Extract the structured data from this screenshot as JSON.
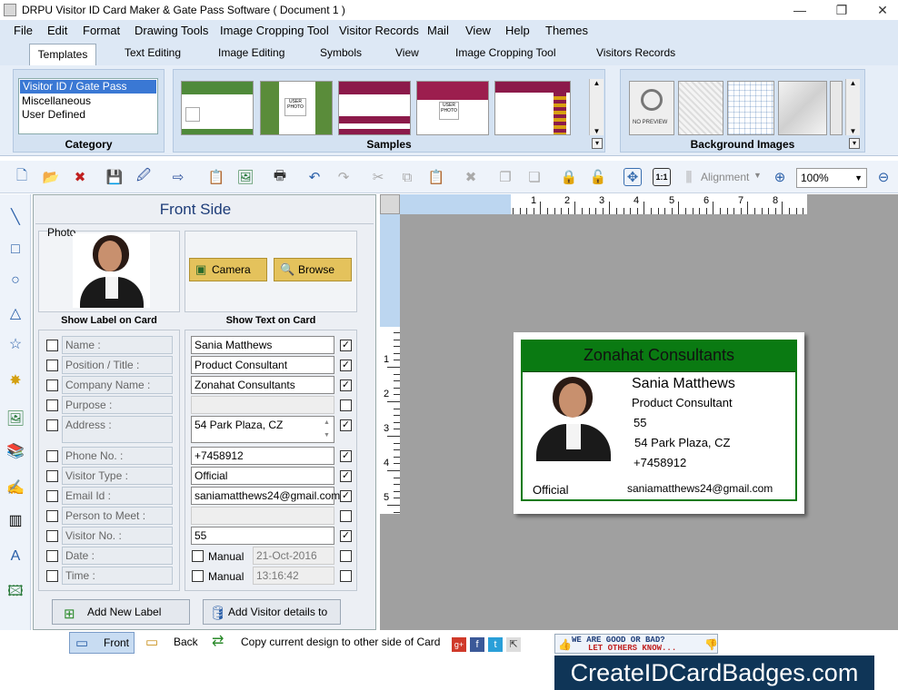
{
  "window": {
    "title": "DRPU Visitor ID Card Maker & Gate Pass Software ( Document 1 )",
    "min": "—",
    "max": "❐",
    "close": "✕"
  },
  "menu": [
    "File",
    "Edit",
    "Format",
    "Drawing Tools",
    "Image Cropping Tool",
    "Visitor Records",
    "Mail",
    "View",
    "Help",
    "Themes"
  ],
  "tabs": [
    "Templates",
    "Text Editing",
    "Image Editing",
    "Symbols",
    "View",
    "Image Cropping Tool",
    "Visitors Records"
  ],
  "ribbon": {
    "category_label": "Category",
    "categories": [
      "Visitor ID / Gate Pass",
      "Miscellaneous",
      "User Defined"
    ],
    "samples_label": "Samples",
    "background_label": "Background Images",
    "no_preview": "NO PREVIEW",
    "user_photo": "USER PHOTO"
  },
  "toolbar": {
    "alignment": "Alignment",
    "zoom": "100%"
  },
  "panel": {
    "title": "Front Side",
    "photo_label": "Photo",
    "camera": "Camera",
    "browse": "Browse",
    "show_label": "Show Label on Card",
    "show_text": "Show Text on Card",
    "rows": [
      {
        "label": "Name :",
        "value": "Sania Matthews",
        "left": false,
        "right": true
      },
      {
        "label": "Position / Title :",
        "value": "Product Consultant",
        "left": false,
        "right": true
      },
      {
        "label": "Company Name :",
        "value": "Zonahat Consultants",
        "left": false,
        "right": true
      },
      {
        "label": "Purpose :",
        "value": "",
        "left": false,
        "right": false
      },
      {
        "label": "Address :",
        "value": "54 Park Plaza, CZ",
        "left": false,
        "right": true
      },
      {
        "label": "Phone No. :",
        "value": "+7458912",
        "left": false,
        "right": true
      },
      {
        "label": "Visitor Type :",
        "value": "Official",
        "left": false,
        "right": true
      },
      {
        "label": "Email Id :",
        "value": "saniamatthews24@gmail.com",
        "left": false,
        "right": true
      },
      {
        "label": "Person to Meet :",
        "value": "",
        "left": false,
        "right": false
      },
      {
        "label": "Visitor No. :",
        "value": "55",
        "left": false,
        "right": true
      },
      {
        "label": "Date :",
        "manual": "Manual",
        "value": "21-Oct-2016",
        "left": false,
        "right": false
      },
      {
        "label": "Time :",
        "manual": "Manual",
        "value": "13:16:42",
        "left": false,
        "right": false
      }
    ],
    "add_label": "Add New Label",
    "add_db": "Add Visitor details to DB"
  },
  "ruler": {
    "h": [
      "1",
      "2",
      "3",
      "4",
      "5",
      "6",
      "7",
      "8"
    ],
    "v": [
      "1",
      "2",
      "3",
      "4",
      "5"
    ]
  },
  "card": {
    "company": "Zonahat Consultants",
    "name": "Sania Matthews",
    "position": "Product Consultant",
    "visitor_no": "55",
    "address": "54 Park Plaza, CZ",
    "phone": "+7458912",
    "type": "Official",
    "email": "saniamatthews24@gmail.com",
    "header_color": "#0a7a12"
  },
  "status": {
    "front": "Front",
    "back": "Back",
    "copy": "Copy current design to other side of Card",
    "rate_line1": "WE ARE GOOD OR BAD?",
    "rate_line2": "LET OTHERS KNOW..."
  },
  "brand": "CreateIDCardBadges.com"
}
